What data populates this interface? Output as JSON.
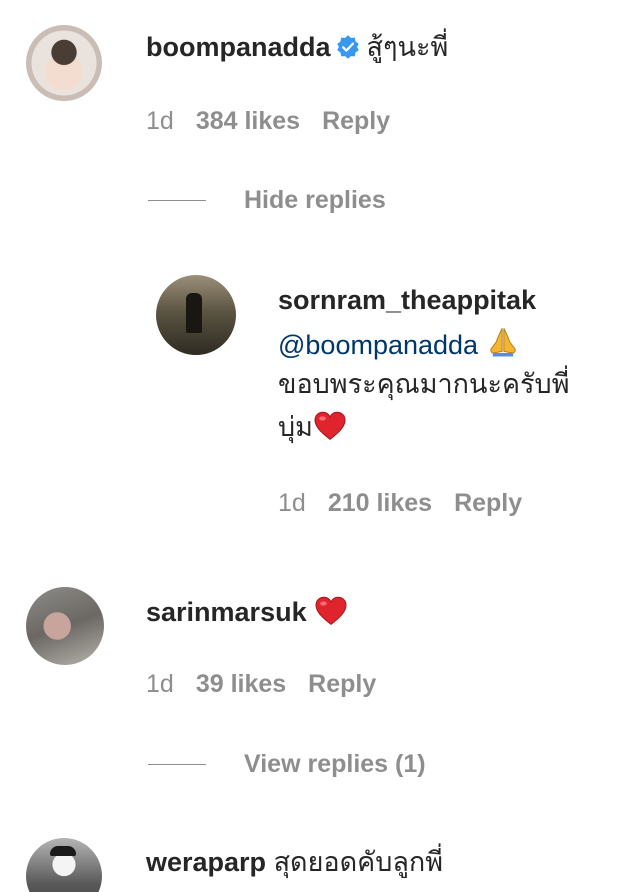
{
  "comments": [
    {
      "username": "boompanadda",
      "verified": true,
      "text": "สู้ๆนะพี่",
      "time": "1d",
      "likes": "384 likes",
      "reply": "Reply",
      "thread_toggle": "Hide replies"
    },
    {
      "username": "sornram_theappitak",
      "mention": "@boompanadda",
      "text_line1": "ขอบพระคุณมากนะครับพี่",
      "text_line2": "บุ่ม",
      "time": "1d",
      "likes": "210 likes",
      "reply": "Reply"
    },
    {
      "username": "sarinmarsuk",
      "time": "1d",
      "likes": "39 likes",
      "reply": "Reply",
      "thread_toggle": "View replies (1)"
    },
    {
      "username": "weraparp",
      "text": "สุดยอดคับลูกพี่"
    }
  ],
  "icons": {
    "verified": "verified-badge-icon",
    "heart": "red-heart-emoji",
    "pray": "folded-hands-emoji"
  },
  "colors": {
    "verified_blue": "#3897f0",
    "mention_blue": "#00376b",
    "meta_gray": "#8e8e8e",
    "heart_red": "#e0242e"
  }
}
